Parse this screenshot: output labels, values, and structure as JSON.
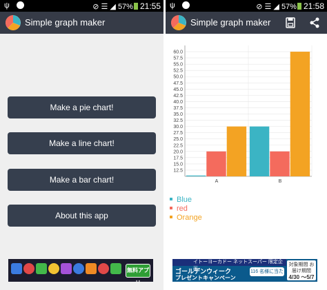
{
  "status_left": {
    "battery": "57%",
    "time": "21:55"
  },
  "status_right": {
    "battery": "57%",
    "time": "21:58"
  },
  "app": {
    "title": "Simple graph maker"
  },
  "menu": {
    "pie": "Make a pie chart!",
    "line": "Make a line chart!",
    "bar": "Make a bar chart!",
    "about": "About this app"
  },
  "ad_left": {
    "button": "無料アプリ"
  },
  "ad_right": {
    "top": "イトーヨーカドー ネットスーパー 限定企画",
    "line1": "ゴールデンウィーク",
    "line2": "プレゼントキャンペーン",
    "badge": "116 名様に当たる!!",
    "cal_head": "対象期間 お届け期間",
    "cal_range": "4/30 ～5/7"
  },
  "colors": {
    "appbar": "#363b47",
    "button": "#363f4e",
    "blue": "#3bb4c4",
    "red": "#f46b5d",
    "orange": "#f3a323"
  },
  "chart_data": {
    "type": "bar",
    "categories": [
      "A",
      "B"
    ],
    "series": [
      {
        "name": "Blue",
        "color": "#3bb4c4",
        "values": [
          0.5,
          30
        ]
      },
      {
        "name": "red",
        "color": "#f46b5d",
        "values": [
          20,
          20
        ]
      },
      {
        "name": "Orange",
        "color": "#f3a323",
        "values": [
          30,
          60
        ]
      }
    ],
    "ylim": [
      10,
      62.5
    ],
    "yticks": [
      "12.5",
      "15.0",
      "17.5",
      "20.0",
      "22.5",
      "25.0",
      "27.5",
      "30.0",
      "32.5",
      "35.0",
      "37.5",
      "40.0",
      "42.5",
      "45.0",
      "47.5",
      "50.0",
      "52.5",
      "55.0",
      "57.5",
      "60.0"
    ],
    "grid": true,
    "legend": "bottom-left"
  }
}
